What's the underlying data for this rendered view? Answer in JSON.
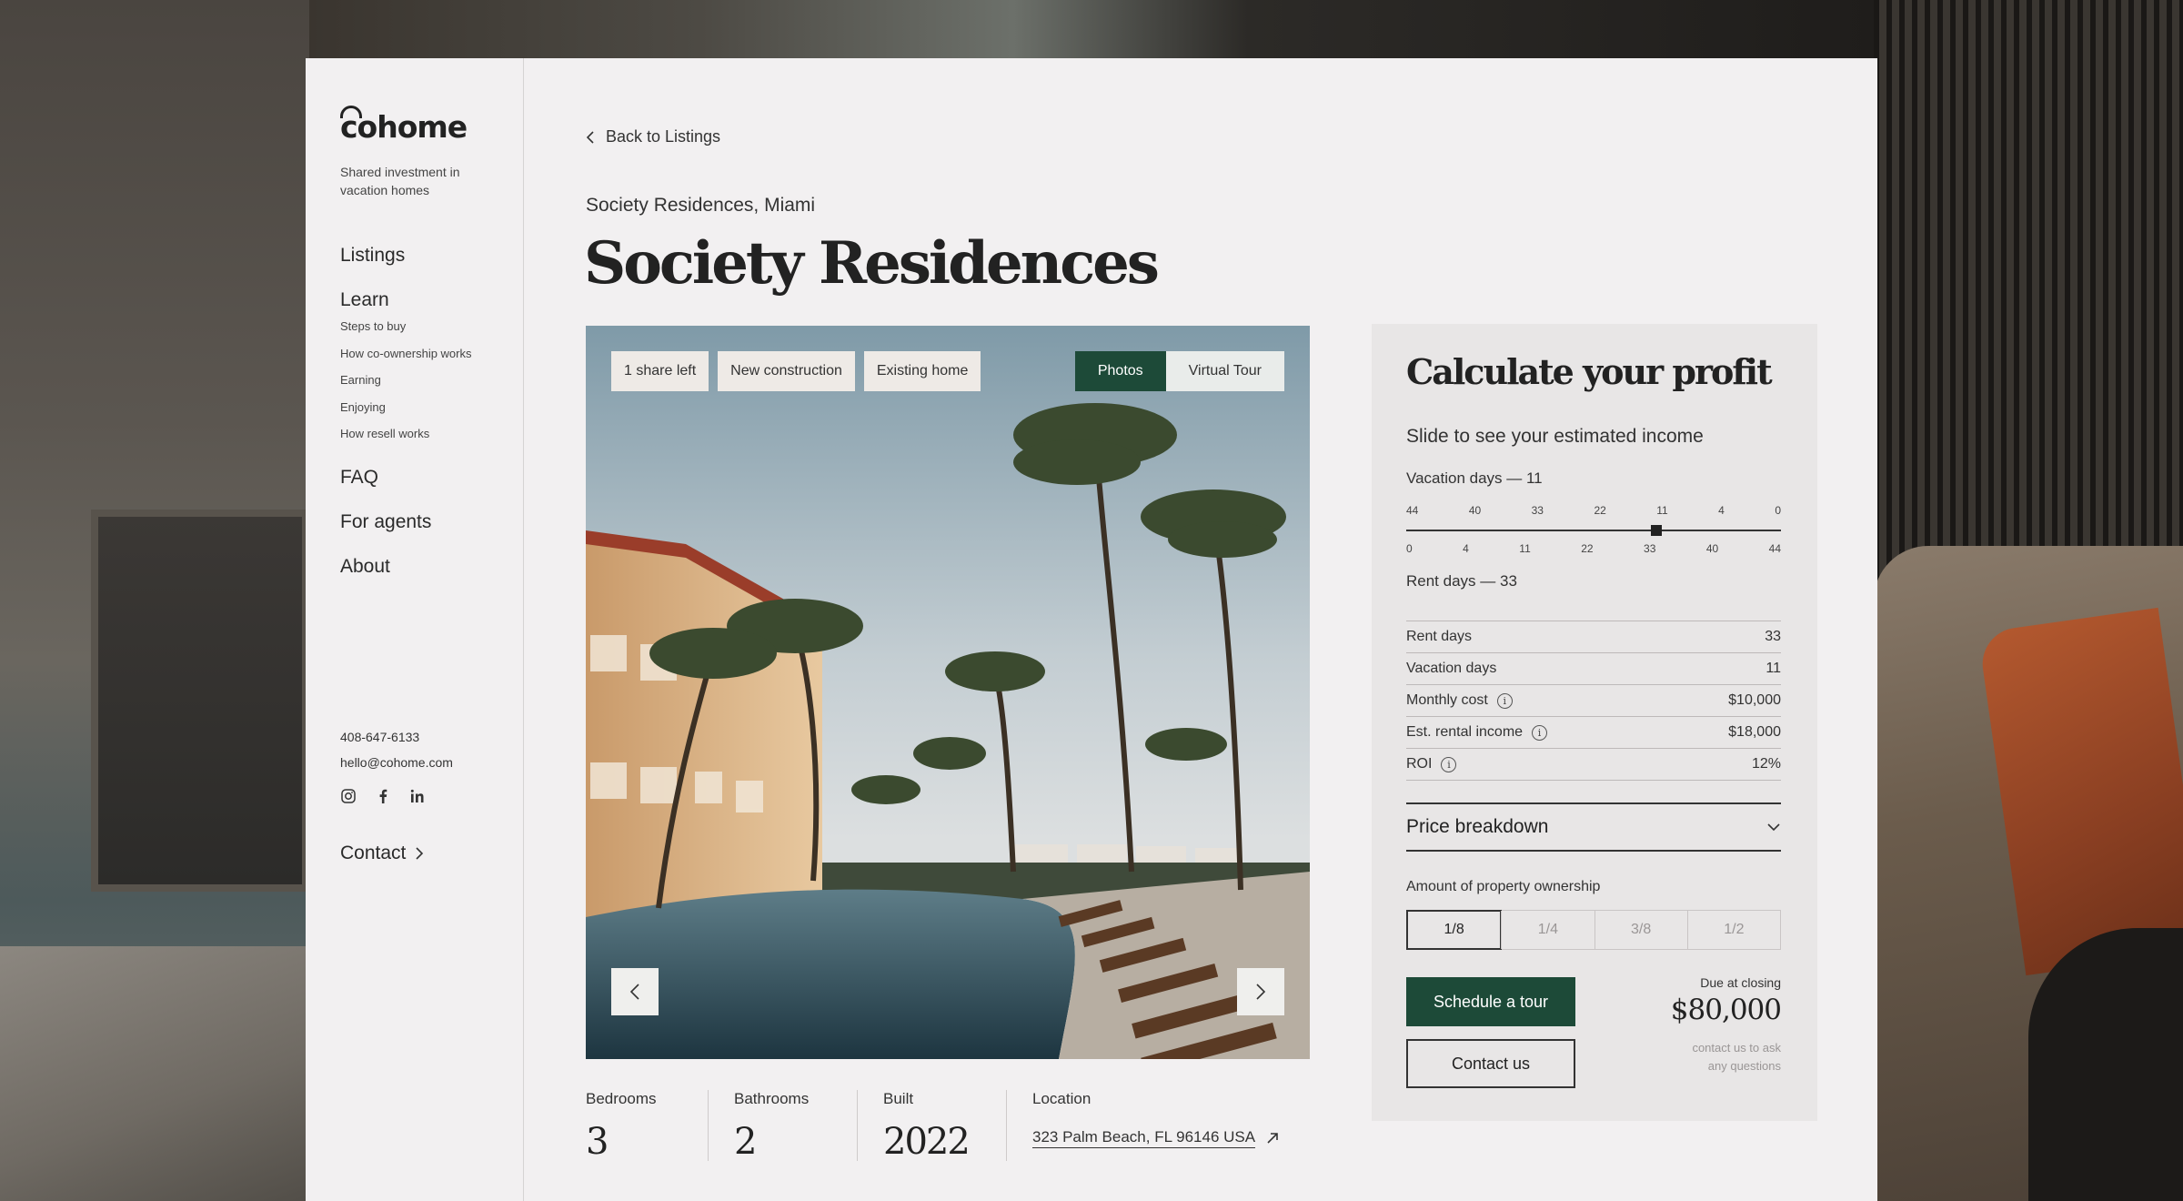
{
  "brand": {
    "logo": "cohome",
    "tagline": "Shared investment in vacation homes"
  },
  "nav": {
    "listings": "Listings",
    "learn": "Learn",
    "learn_items": [
      "Steps to buy",
      "How co-ownership works",
      "Earning",
      "Enjoying",
      "How resell works"
    ],
    "faq": "FAQ",
    "for_agents": "For agents",
    "about": "About"
  },
  "contact": {
    "phone": "408-647-6133",
    "email": "hello@cohome.com",
    "socials": [
      "instagram-icon",
      "facebook-icon",
      "linkedin-icon"
    ],
    "link_label": "Contact"
  },
  "header": {
    "back_label": "Back to Listings",
    "subtitle": "Society Residences, Miami",
    "title": "Society Residences"
  },
  "gallery": {
    "tags": [
      "1 share left",
      "New construction",
      "Existing home"
    ],
    "views": [
      "Photos",
      "Virtual Tour"
    ],
    "active_view": "Photos"
  },
  "stats": {
    "bedrooms_label": "Bedrooms",
    "bedrooms": "3",
    "bathrooms_label": "Bathrooms",
    "bathrooms": "2",
    "built_label": "Built",
    "built": "2022",
    "location_label": "Location",
    "location": "323 Palm Beach, FL 96146 USA"
  },
  "calculator": {
    "title": "Calculate your profit",
    "subtitle": "Slide to see your estimated income",
    "vacation_label": "Vacation days — 11",
    "rent_label": "Rent days — 33",
    "ticks_top": [
      "44",
      "40",
      "33",
      "22",
      "11",
      "4",
      "0"
    ],
    "ticks_bottom": [
      "0",
      "4",
      "11",
      "22",
      "33",
      "40",
      "44"
    ],
    "slider_position_index": 4,
    "rows": [
      {
        "key": "Rent days",
        "value": "33",
        "info": false
      },
      {
        "key": "Vacation days",
        "value": "11",
        "info": false
      },
      {
        "key": "Monthly cost",
        "value": "$10,000",
        "info": true
      },
      {
        "key": "Est. rental income",
        "value": "$18,000",
        "info": true
      },
      {
        "key": "ROI",
        "value": "12%",
        "info": true
      }
    ],
    "breakdown_label": "Price breakdown",
    "ownership_label": "Amount of property ownership",
    "ownership_options": [
      "1/8",
      "1/4",
      "3/8",
      "1/2"
    ],
    "ownership_selected": "1/8",
    "schedule_label": "Schedule a tour",
    "contact_label": "Contact us",
    "due_caption": "Due at closing",
    "due_price": "$80,000",
    "due_note_1": "contact us to ask",
    "due_note_2": "any questions"
  },
  "colors": {
    "accent": "#1d4a38",
    "page": "#f2f0f1",
    "panel": "#e8e6e6"
  }
}
